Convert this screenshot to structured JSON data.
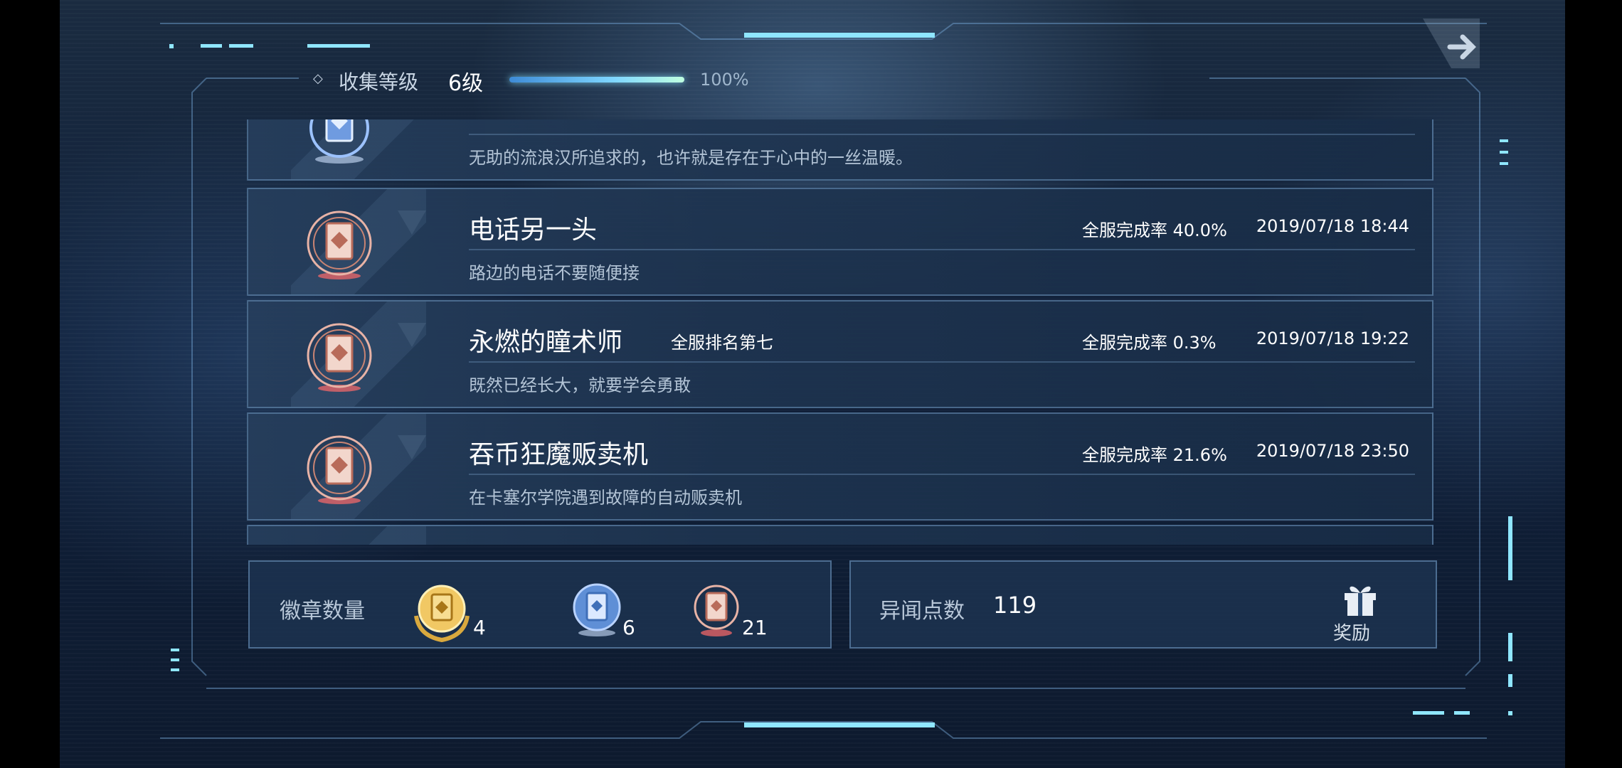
{
  "header": {
    "level_label": "收集等级",
    "level_value": "6级",
    "level_progress": 1.0,
    "level_percent_text": "100%"
  },
  "achievements": [
    {
      "title": "",
      "rank": "",
      "rate": "",
      "date": "",
      "description": "无助的流浪汉所追求的，也许就是存在于心中的一丝温暖。",
      "tier": "silver"
    },
    {
      "title": "电话另一头",
      "rank": "",
      "rate": "全服完成率 40.0%",
      "date": "2019/07/18 18:44",
      "description": "路边的电话不要随便接",
      "tier": "bronze"
    },
    {
      "title": "永燃的瞳术师",
      "rank": "全服排名第七",
      "rate": "全服完成率 0.3%",
      "date": "2019/07/18 19:22",
      "description": "既然已经长大，就要学会勇敢",
      "tier": "bronze"
    },
    {
      "title": "吞币狂魔贩卖机",
      "rank": "",
      "rate": "全服完成率 21.6%",
      "date": "2019/07/18 23:50",
      "description": "在卡塞尔学院遇到故障的自动贩卖机",
      "tier": "bronze"
    }
  ],
  "badges": {
    "label": "徽章数量",
    "gold_count": "4",
    "silver_count": "6",
    "bronze_count": "21"
  },
  "points": {
    "label": "异闻点数",
    "value": "119",
    "reward_label": "奖励"
  },
  "colors": {
    "accent_cyan": "#7fe3ff",
    "gold": "#e6b84a",
    "silver": "#7fa7e6",
    "bronze": "#e39a86"
  },
  "icons": {
    "level": "diamond-icon",
    "reward": "gift-icon",
    "next": "arrow-right-icon"
  }
}
